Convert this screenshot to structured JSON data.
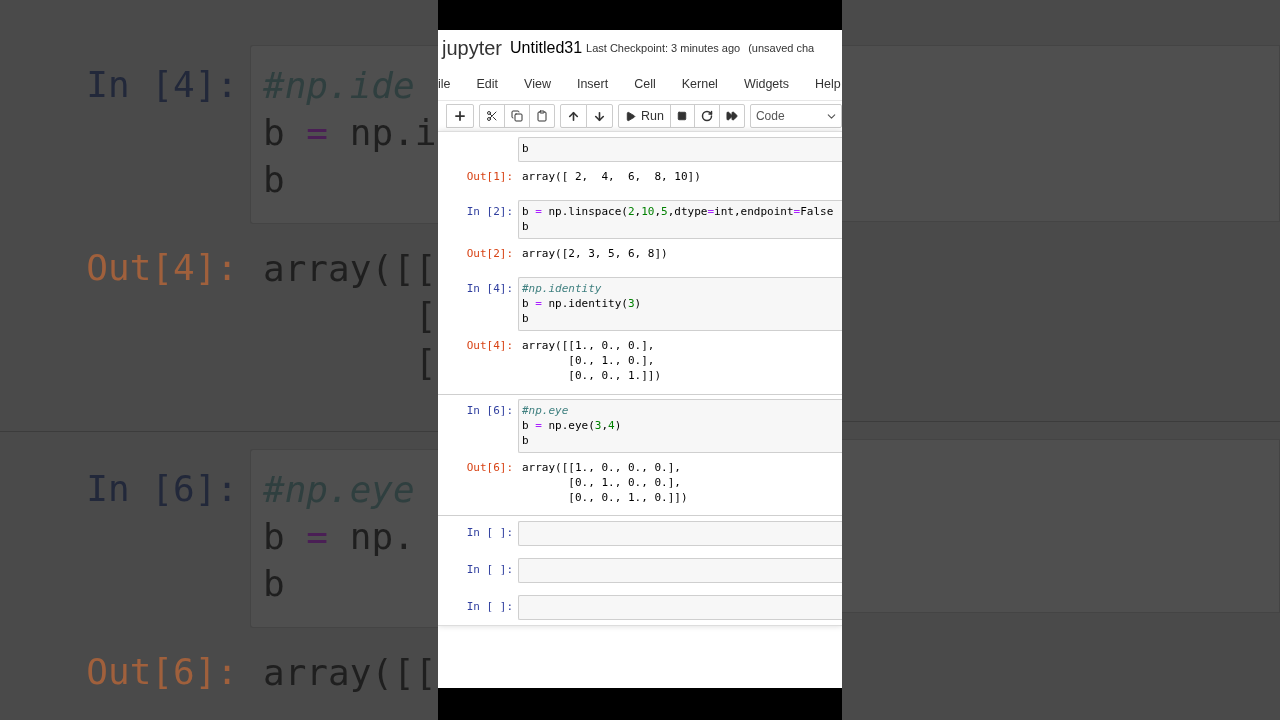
{
  "backdrop": {
    "cells": [
      {
        "in_prompt": "In [4]:",
        "code": [
          "#np.ide",
          "b = np.i",
          "b"
        ],
        "out_prompt": "Out[4]:",
        "output": [
          "array([[",
          "       [",
          "       ["
        ]
      },
      {
        "in_prompt": "In [6]:",
        "code": [
          "#np.eye",
          "b = np.",
          "b"
        ],
        "out_prompt": "Out[6]:",
        "output": [
          "array([["
        ]
      }
    ]
  },
  "header": {
    "logo": "jupyter",
    "title": "Untitled31",
    "checkpoint": "Last Checkpoint: 3 minutes ago",
    "status": "(unsaved cha"
  },
  "menu": [
    "ile",
    "Edit",
    "View",
    "Insert",
    "Cell",
    "Kernel",
    "Widgets",
    "Help"
  ],
  "toolbar": {
    "run_label": "Run",
    "cell_type": "Code"
  },
  "cells": [
    {
      "code": [
        "b"
      ],
      "out_prompt": "Out[1]:",
      "output": [
        "array([ 2,  4,  6,  8, 10])"
      ],
      "selected": false
    },
    {
      "in_prompt": "In [2]:",
      "code": [
        "b = np.linspace(2,10,5,dtype=int,endpoint=False",
        "b"
      ],
      "out_prompt": "Out[2]:",
      "output": [
        "array([2, 3, 5, 6, 8])"
      ],
      "selected": false
    },
    {
      "in_prompt": "In [4]:",
      "code": [
        "#np.identity",
        "b = np.identity(3)",
        "b"
      ],
      "out_prompt": "Out[4]:",
      "output": [
        "array([[1., 0., 0.],",
        "       [0., 1., 0.],",
        "       [0., 0., 1.]])"
      ],
      "selected": false
    },
    {
      "in_prompt": "In [6]:",
      "code": [
        "#np.eye",
        "b = np.eye(3,4)",
        "b"
      ],
      "out_prompt": "Out[6]:",
      "output": [
        "array([[1., 0., 0., 0.],",
        "       [0., 1., 0., 0.],",
        "       [0., 0., 1., 0.]])"
      ],
      "selected": true
    },
    {
      "in_prompt": "In [ ]:",
      "selected": false
    },
    {
      "in_prompt": "In [ ]:",
      "selected": false
    },
    {
      "in_prompt": "In [ ]:",
      "selected": false
    }
  ]
}
